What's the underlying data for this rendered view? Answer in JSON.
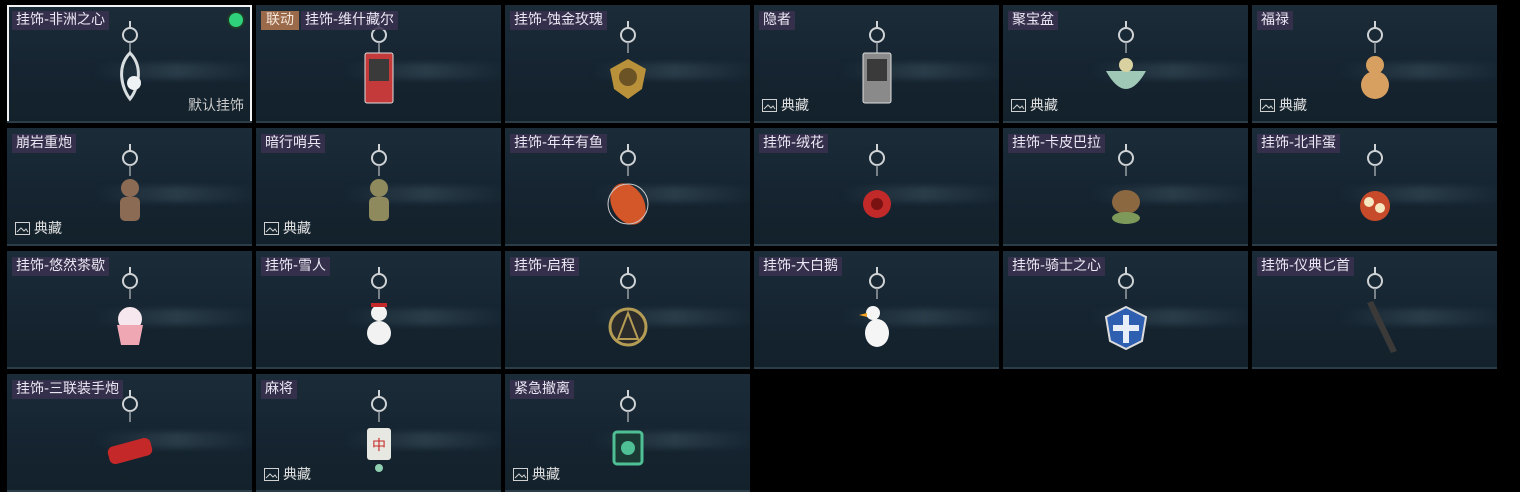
{
  "default_label": "默认挂饰",
  "collection_label": "典藏",
  "colors": {
    "selected_dot": "#2fd27a",
    "link_badge": "#9b6a4a",
    "name_bg": "#3a304e"
  },
  "items": [
    {
      "name": "挂饰-非洲之心",
      "selected": true,
      "is_default": true,
      "charm": "heart-crystal",
      "color": "#d8dde0"
    },
    {
      "name": "挂饰-维什藏尔",
      "badge": "联动",
      "charm": "card",
      "color": "#c43a3a"
    },
    {
      "name": "挂饰-蚀金玫瑰",
      "charm": "gold-rose",
      "color": "#b8913a"
    },
    {
      "name": "隐者",
      "collection": true,
      "charm": "card",
      "color": "#8a8a8a"
    },
    {
      "name": "聚宝盆",
      "collection": true,
      "charm": "bowl",
      "color": "#9fc9b6"
    },
    {
      "name": "福禄",
      "collection": true,
      "charm": "gourd",
      "color": "#d8a060"
    },
    {
      "name": "崩岩重炮",
      "collection": true,
      "charm": "figure",
      "color": "#8c6b55"
    },
    {
      "name": "暗行哨兵",
      "collection": true,
      "charm": "figure",
      "color": "#8f8a5e"
    },
    {
      "name": "挂饰-年年有鱼",
      "charm": "fish",
      "color": "#d4572a"
    },
    {
      "name": "挂饰-绒花",
      "charm": "rose",
      "color": "#c22929"
    },
    {
      "name": "挂饰-卡皮巴拉",
      "charm": "capybara",
      "color": "#8c6840"
    },
    {
      "name": "挂饰-北非蛋",
      "charm": "pan",
      "color": "#c74a2a"
    },
    {
      "name": "挂饰-悠然茶歇",
      "charm": "cupcake",
      "color": "#f0a7b4"
    },
    {
      "name": "挂饰-雪人",
      "charm": "snowman",
      "color": "#f2f2f2"
    },
    {
      "name": "挂饰-启程",
      "charm": "medal",
      "color": "#b59c55"
    },
    {
      "name": "挂饰-大白鹅",
      "charm": "goose",
      "color": "#f5f5f5"
    },
    {
      "name": "挂饰-骑士之心",
      "charm": "shield",
      "color": "#2f5fb0"
    },
    {
      "name": "挂饰-仪典匕首",
      "charm": "dagger",
      "color": "#3b3a38"
    },
    {
      "name": "挂饰-三联装手炮",
      "charm": "cannon",
      "color": "#c52828"
    },
    {
      "name": "麻将",
      "collection": true,
      "charm": "mahjong",
      "color": "#e8e8e2"
    },
    {
      "name": "紧急撤离",
      "collection": true,
      "charm": "frame",
      "color": "#4fbf96"
    }
  ]
}
